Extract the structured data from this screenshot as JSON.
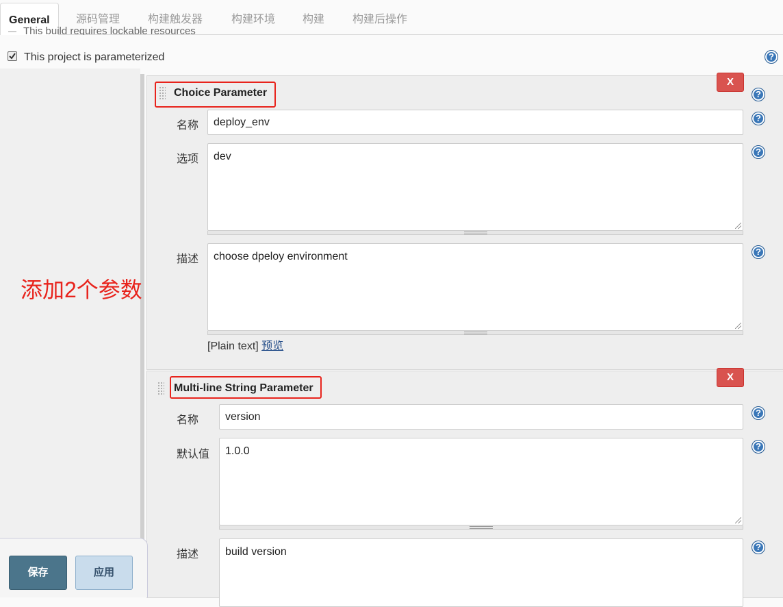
{
  "tabs": [
    "General",
    "源码管理",
    "构建触发器",
    "构建环境",
    "构建",
    "构建后操作"
  ],
  "clipped_option": "This build requires lockable resources",
  "parameterized": {
    "label": "This project is parameterized",
    "checked": true
  },
  "help_glyph": "?",
  "annotation": "添加2个参数",
  "choice_param": {
    "title": "Choice Parameter",
    "delete_label": "X",
    "name_label": "名称",
    "name_value": "deploy_env",
    "choices_label": "选项",
    "choices_value": "dev",
    "desc_label": "描述",
    "desc_value": "choose dpeloy environment",
    "plain_text": "[Plain text]",
    "preview": "预览"
  },
  "multiline_param": {
    "title": "Multi-line String Parameter",
    "delete_label": "X",
    "name_label": "名称",
    "name_value": "version",
    "default_label": "默认值",
    "default_value": "1.0.0",
    "desc_label": "描述",
    "desc_value": "build version"
  },
  "buttons": {
    "save": "保存",
    "apply": "应用"
  },
  "colors": {
    "annotation": "#e8231c",
    "delete": "#d9534f",
    "save": "#4b758b",
    "apply": "#c9dcec",
    "help": "#3a77b8"
  },
  "icons": [
    "help-icon",
    "checkbox-icon",
    "drag-handle-icon",
    "resize-grip-icon"
  ]
}
